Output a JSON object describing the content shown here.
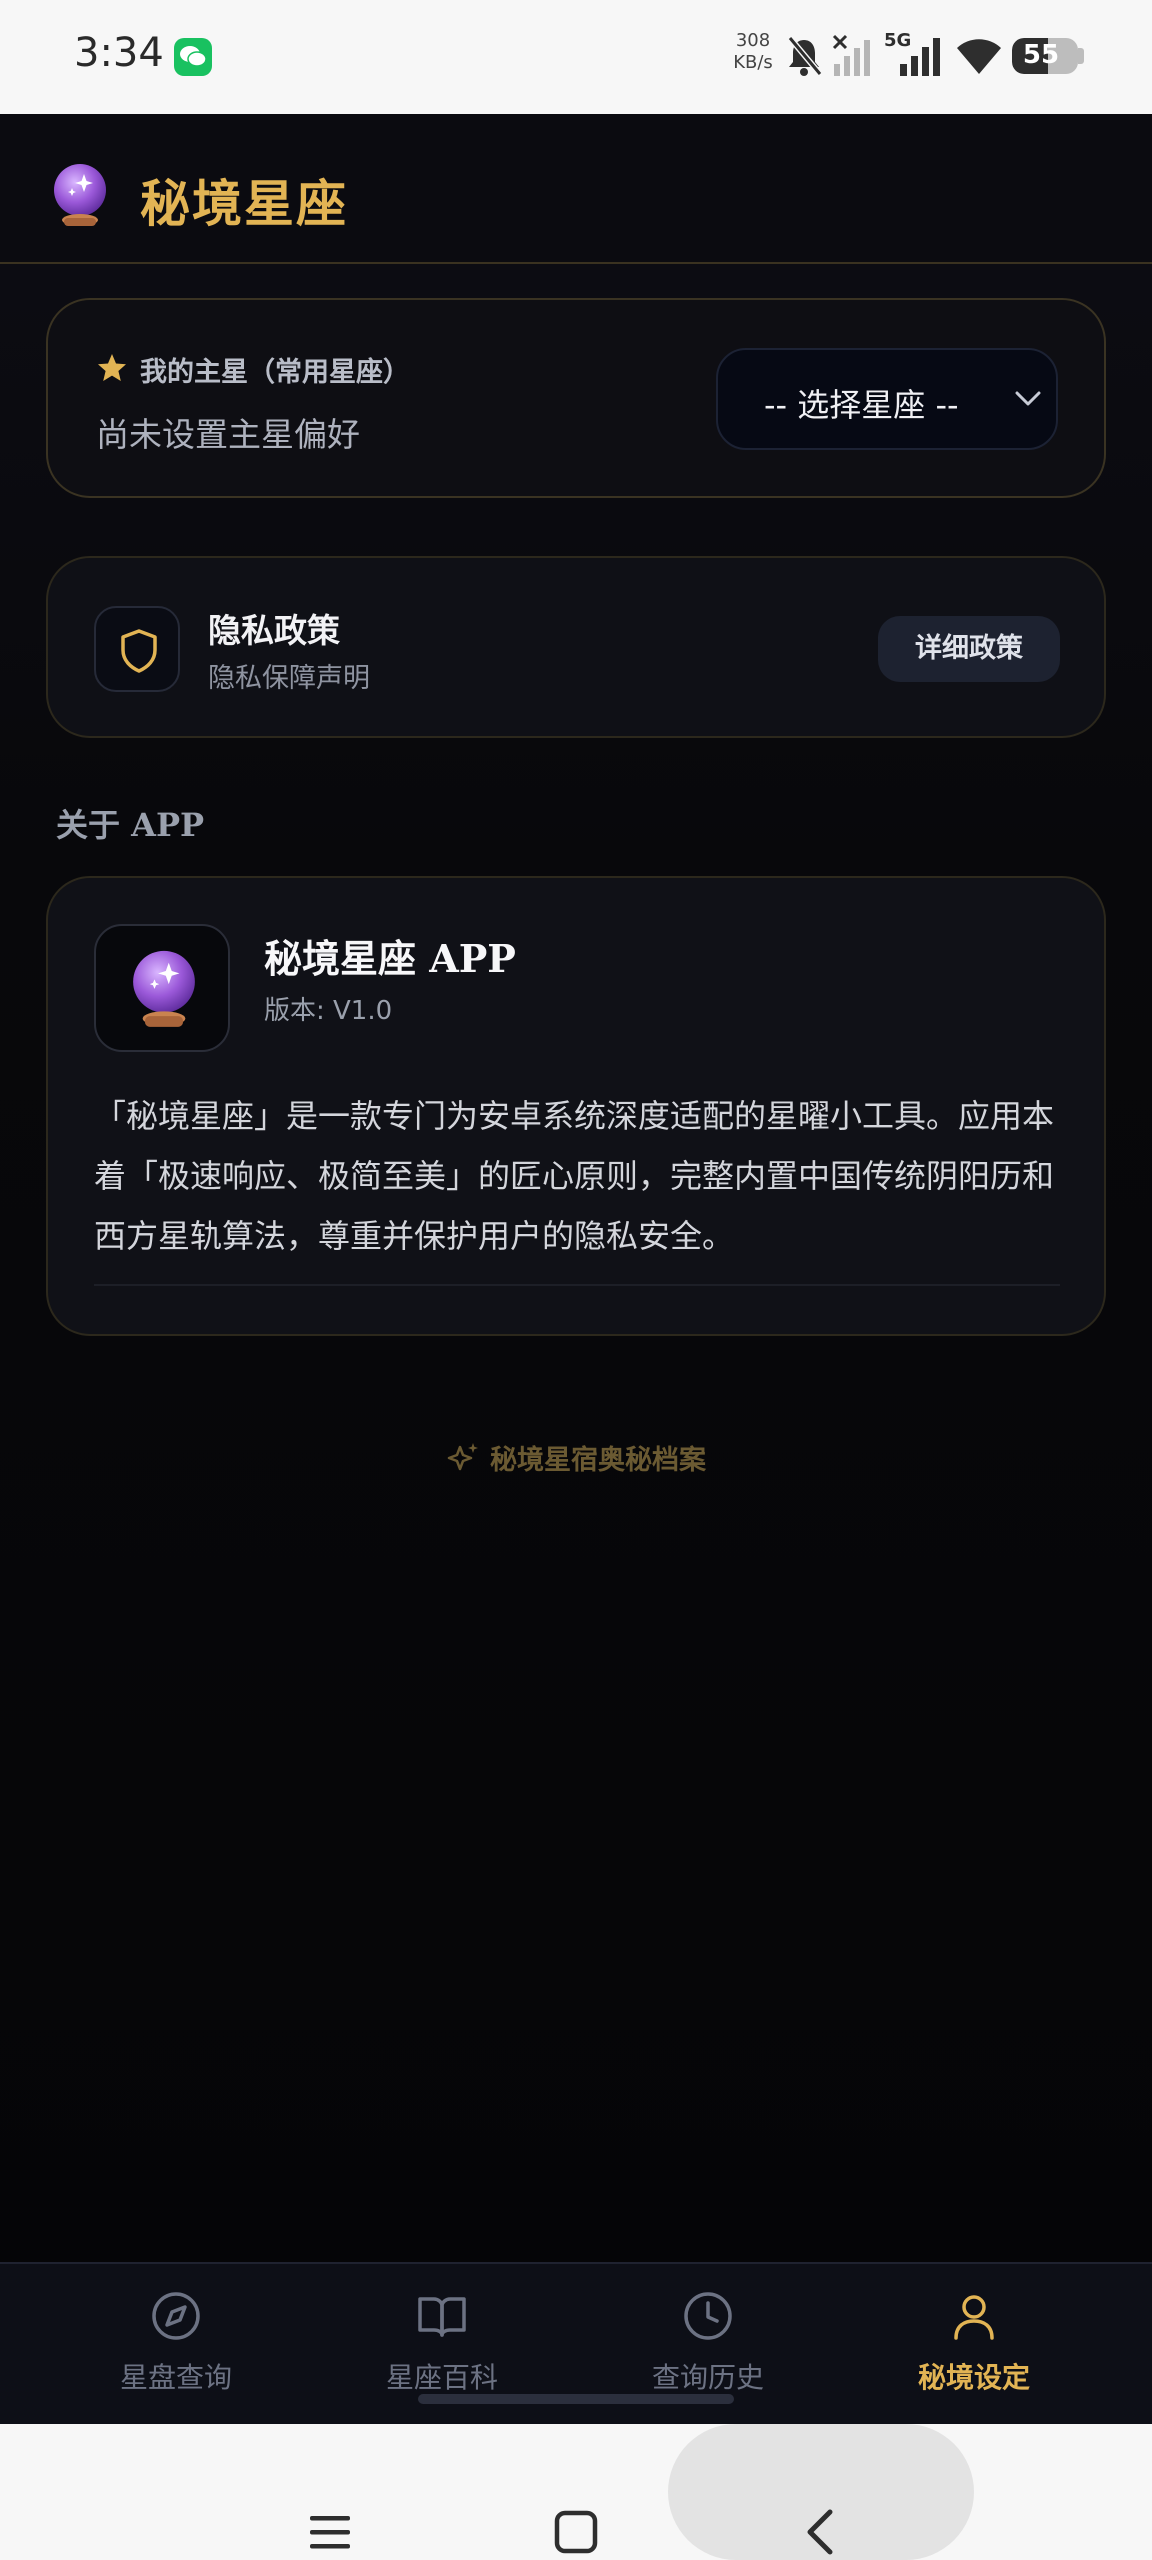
{
  "status_bar": {
    "time": "3:34",
    "net_speed_value": "308",
    "net_speed_unit": "KB/s",
    "network_label": "5G",
    "battery": "55",
    "battery_level": 0.55
  },
  "header": {
    "logo_icon": "crystal-ball-icon",
    "title": "秘境星座"
  },
  "favorite": {
    "icon": "star-icon",
    "title": "我的主星（常用星座）",
    "subtitle": "尚未设置主星偏好",
    "select_value": "-- 选择星座 --"
  },
  "privacy": {
    "icon": "shield-icon",
    "title": "隐私政策",
    "subtitle": "隐私保障声明",
    "button_label": "详细政策"
  },
  "about": {
    "section_label": "关于 APP",
    "app_name": "秘境星座 APP",
    "version": "版本: V1.0",
    "description": "「秘境星座」是一款专门为安卓系统深度适配的星曜小工具。应用本着「极速响应、极简至美」的匠心原则，完整内置中国传统阴阳历和西方星轨算法，尊重并保护用户的隐私安全。"
  },
  "footer_tag": "秘境星宿奥秘档案",
  "bottom_nav": {
    "items": [
      {
        "label": "星盘查询",
        "icon": "compass-icon"
      },
      {
        "label": "星座百科",
        "icon": "book-icon"
      },
      {
        "label": "查询历史",
        "icon": "clock-icon"
      },
      {
        "label": "秘境设定",
        "icon": "user-icon"
      }
    ],
    "active_index": 3
  },
  "colors": {
    "accent_gold": "#e2b454",
    "background": "#050508",
    "card": "#0f1016"
  }
}
